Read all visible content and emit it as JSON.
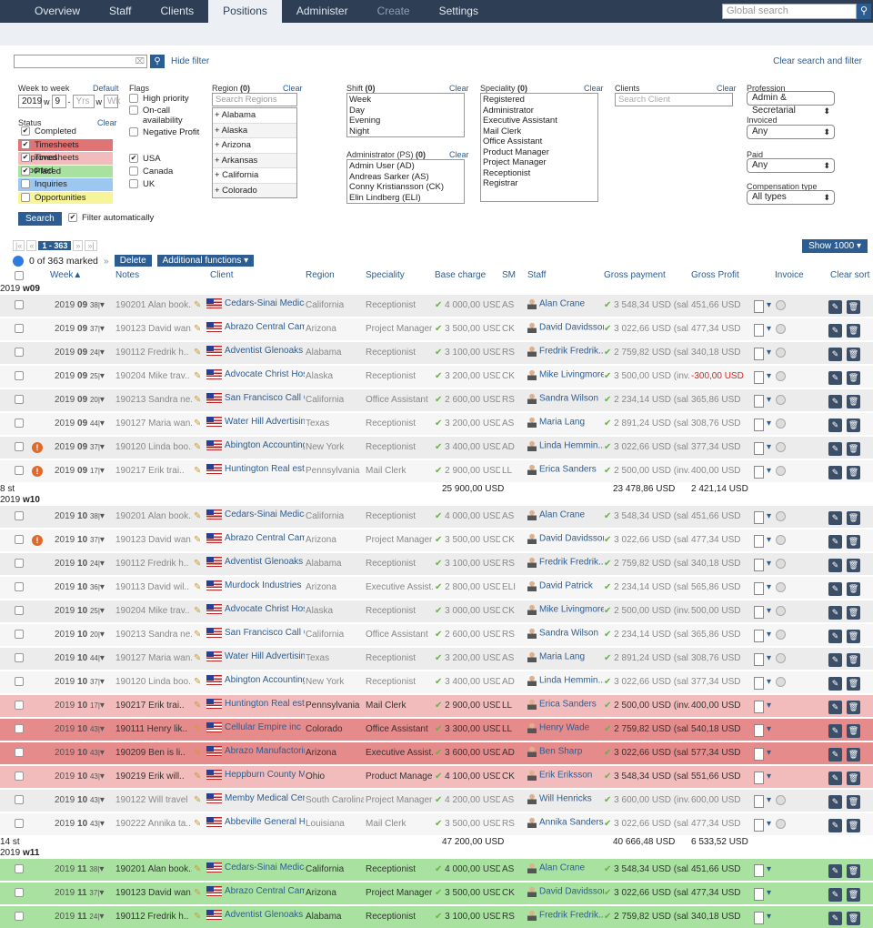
{
  "nav": {
    "tabs": [
      "Overview",
      "Staff",
      "Clients",
      "Positions",
      "Administer",
      "Create",
      "Settings"
    ],
    "active": 3,
    "dim": [
      5
    ],
    "search_placeholder": "Global search"
  },
  "filter": {
    "hide_filter": "Hide filter",
    "clear_all": "Clear search and filter",
    "week_label": "Week to week",
    "week_default": "Default",
    "year": "2019",
    "w": "w",
    "week": "9",
    "dash": "-",
    "yrs_ph": "Yrs",
    "wk_ph": "Wk",
    "status_label": "Status",
    "clear": "Clear",
    "statuses": [
      {
        "label": "Completed",
        "checked": true,
        "color": "#ffffff"
      },
      {
        "label": "Timesheets approved",
        "checked": true,
        "color": "#e07373"
      },
      {
        "label": "Timesheets reported",
        "checked": true,
        "color": "#f2bcbc"
      },
      {
        "label": "Placed",
        "checked": true,
        "color": "#a9e2a0"
      },
      {
        "label": "Inquiries",
        "checked": false,
        "color": "#9cc7f0"
      },
      {
        "label": "Opportunities",
        "checked": false,
        "color": "#f7f59a"
      }
    ],
    "search_btn": "Search",
    "filter_auto": "Filter automatically",
    "flags_label": "Flags",
    "flags": [
      "High priority",
      "On-call availability",
      "Negative Profit"
    ],
    "countries": [
      {
        "label": "USA",
        "checked": true
      },
      {
        "label": "Canada",
        "checked": false
      },
      {
        "label": "UK",
        "checked": false
      }
    ],
    "region_label": "Region",
    "region_count": "(0)",
    "region_search": "Search Regions",
    "regions": [
      "+ Alabama",
      "+ Alaska",
      "+ Arizona",
      "+ Arkansas",
      "+ California",
      "+ Colorado"
    ],
    "shift_label": "Shift",
    "shift_count": "(0)",
    "shifts": [
      "Week",
      "Day",
      "Evening",
      "Night"
    ],
    "admin_label": "Administrator (PS)",
    "admin_count": "(0)",
    "admins": [
      "Admin User (AD)",
      "Andreas Sarker (AS)",
      "Conny Kristiansson (CK)",
      "Elin Lindberg (ELI)"
    ],
    "spec_label": "Speciality",
    "spec_count": "(0)",
    "specs": [
      "Registered",
      "Administrator",
      "Executive Assistant",
      "Mail Clerk",
      "Office Assistant",
      "Product Manager",
      "Project Manager",
      "Receptionist",
      "Registrar"
    ],
    "clients_label": "Clients",
    "clients_search": "Search Client",
    "profession_label": "Profession",
    "profession": "Admin & Secretarial",
    "invoiced_label": "Invoiced",
    "invoiced": "Any",
    "paid_label": "Paid",
    "paid": "Any",
    "comp_label": "Compensation type",
    "comp": "All types"
  },
  "pager": {
    "first": "|«",
    "prev": "«",
    "range": "1 - 363",
    "next": "»",
    "last": "»|",
    "show": "Show 1000"
  },
  "actions": {
    "marked": "0 of 363 marked",
    "arrows": "»",
    "delete": "Delete",
    "additional": "Additional functions"
  },
  "columns": {
    "week": "Week",
    "notes": "Notes",
    "client": "Client",
    "region": "Region",
    "speciality": "Speciality",
    "base": "Base charge",
    "sm": "SM",
    "staff": "Staff",
    "gross": "Gross payment",
    "profit": "Gross Profit",
    "invoice": "Invoice",
    "clear_sort": "Clear sort"
  },
  "groups": [
    {
      "label": "2019",
      "week": "w09",
      "total_count": "8 st",
      "total_base": "25 900,00 USD",
      "total_gross": "23 478,86 USD",
      "total_profit": "2 421,14 USD",
      "rows": [
        {
          "c": "n",
          "y": "2019",
          "w": "09",
          "d": "38|",
          "note": "190201 Alan book..",
          "client": "Cedars-Sinai Medical...",
          "region": "California",
          "spec": "Receptionist",
          "base": "4 000,00 USD",
          "sm": "AS",
          "staff": "Alan Crane",
          "gross": "3 548,34 USD (sal...",
          "profit": "451,66 USD",
          "warn": false,
          "neg": false
        },
        {
          "c": "n",
          "y": "2019",
          "w": "09",
          "d": "37|",
          "note": "190123 David wan..",
          "client": "Abrazo Central Cam...",
          "region": "Arizona",
          "spec": "Project Manager",
          "base": "3 500,00 USD",
          "sm": "CK",
          "staff": "David Davidsson",
          "gross": "3 022,66 USD (sal...",
          "profit": "477,34 USD",
          "warn": false,
          "neg": false
        },
        {
          "c": "n",
          "y": "2019",
          "w": "09",
          "d": "24|",
          "note": "190112 Fredrik h..",
          "client": "Adventist Glenoaks",
          "region": "Alabama",
          "spec": "Receptionist",
          "base": "3 100,00 USD",
          "sm": "RS",
          "staff": "Fredrik Fredrik...",
          "gross": "2 759,82 USD (sal...",
          "profit": "340,18 USD",
          "warn": false,
          "neg": false
        },
        {
          "c": "n",
          "y": "2019",
          "w": "09",
          "d": "25|",
          "note": "190204 Mike trav..",
          "client": "Advocate Christ Hos...",
          "region": "Alaska",
          "spec": "Receptionist",
          "base": "3 200,00 USD",
          "sm": "CK",
          "staff": "Mike Livingmore",
          "gross": "3 500,00 USD (inv...",
          "profit": "-300,00 USD",
          "warn": false,
          "neg": true
        },
        {
          "c": "n",
          "y": "2019",
          "w": "09",
          "d": "20|",
          "note": "190213 Sandra ne..",
          "client": "San Francisco Call C...",
          "region": "California",
          "spec": "Office Assistant",
          "base": "2 600,00 USD",
          "sm": "RS",
          "staff": "Sandra Wilson",
          "gross": "2 234,14 USD (sal...",
          "profit": "365,86 USD",
          "warn": false,
          "neg": false
        },
        {
          "c": "n",
          "y": "2019",
          "w": "09",
          "d": "44|",
          "note": "190127 Maria wan..",
          "client": "Water Hill Advertising",
          "region": "Texas",
          "spec": "Receptionist",
          "base": "3 200,00 USD",
          "sm": "AS",
          "staff": "Maria Lang",
          "gross": "2 891,24 USD (sal...",
          "profit": "308,76 USD",
          "warn": false,
          "neg": false
        },
        {
          "c": "n",
          "y": "2019",
          "w": "09",
          "d": "37|",
          "note": "190120 Linda boo..",
          "client": "Abington Accounting...",
          "region": "New York",
          "spec": "Receptionist",
          "base": "3 400,00 USD",
          "sm": "AD",
          "staff": "Linda Hemmin...",
          "gross": "3 022,66 USD (sal...",
          "profit": "377,34 USD",
          "warn": true,
          "neg": false
        },
        {
          "c": "n",
          "y": "2019",
          "w": "09",
          "d": "17|",
          "note": "190217 Erik trai..",
          "client": "Huntington Real est...",
          "region": "Pennsylvania",
          "spec": "Mail Clerk",
          "base": "2 900,00 USD",
          "sm": "LL",
          "staff": "Erica Sanders",
          "gross": "2 500,00 USD (inv...",
          "profit": "400,00 USD",
          "warn": true,
          "neg": false
        }
      ]
    },
    {
      "label": "2019",
      "week": "w10",
      "total_count": "14 st",
      "total_base": "47 200,00 USD",
      "total_gross": "40 666,48 USD",
      "total_profit": "6 533,52 USD",
      "rows": [
        {
          "c": "n",
          "y": "2019",
          "w": "10",
          "d": "38|",
          "note": "190201 Alan book..",
          "client": "Cedars-Sinai Medical...",
          "region": "California",
          "spec": "Receptionist",
          "base": "4 000,00 USD",
          "sm": "AS",
          "staff": "Alan Crane",
          "gross": "3 548,34 USD (sal...",
          "profit": "451,66 USD",
          "warn": false,
          "neg": false
        },
        {
          "c": "n",
          "y": "2019",
          "w": "10",
          "d": "37|",
          "note": "190123 David wan..",
          "client": "Abrazo Central Cam...",
          "region": "Arizona",
          "spec": "Project Manager",
          "base": "3 500,00 USD",
          "sm": "CK",
          "staff": "David Davidsson",
          "gross": "3 022,66 USD (sal...",
          "profit": "477,34 USD",
          "warn": true,
          "neg": false
        },
        {
          "c": "n",
          "y": "2019",
          "w": "10",
          "d": "24|",
          "note": "190112 Fredrik h..",
          "client": "Adventist Glenoaks",
          "region": "Alabama",
          "spec": "Receptionist",
          "base": "3 100,00 USD",
          "sm": "RS",
          "staff": "Fredrik Fredrik...",
          "gross": "2 759,82 USD (sal...",
          "profit": "340,18 USD",
          "warn": false,
          "neg": false
        },
        {
          "c": "n",
          "y": "2019",
          "w": "10",
          "d": "36|",
          "note": "190113 David wil..",
          "client": "Murdock Industries",
          "region": "Arizona",
          "spec": "Executive Assist...",
          "base": "2 800,00 USD",
          "sm": "ELI",
          "staff": "David Patrick",
          "gross": "2 234,14 USD (sal...",
          "profit": "565,86 USD",
          "warn": false,
          "neg": false
        },
        {
          "c": "n",
          "y": "2019",
          "w": "10",
          "d": "25|",
          "note": "190204 Mike trav..",
          "client": "Advocate Christ Hos...",
          "region": "Alaska",
          "spec": "Receptionist",
          "base": "3 000,00 USD",
          "sm": "CK",
          "staff": "Mike Livingmore",
          "gross": "2 500,00 USD (inv...",
          "profit": "500,00 USD",
          "warn": false,
          "neg": false
        },
        {
          "c": "n",
          "y": "2019",
          "w": "10",
          "d": "20|",
          "note": "190213 Sandra ne..",
          "client": "San Francisco Call C...",
          "region": "California",
          "spec": "Office Assistant",
          "base": "2 600,00 USD",
          "sm": "RS",
          "staff": "Sandra Wilson",
          "gross": "2 234,14 USD (sal...",
          "profit": "365,86 USD",
          "warn": false,
          "neg": false
        },
        {
          "c": "n",
          "y": "2019",
          "w": "10",
          "d": "44|",
          "note": "190127 Maria wan..",
          "client": "Water Hill Advertising",
          "region": "Texas",
          "spec": "Receptionist",
          "base": "3 200,00 USD",
          "sm": "AS",
          "staff": "Maria Lang",
          "gross": "2 891,24 USD (sal...",
          "profit": "308,76 USD",
          "warn": false,
          "neg": false
        },
        {
          "c": "n",
          "y": "2019",
          "w": "10",
          "d": "37|",
          "note": "190120 Linda boo..",
          "client": "Abington Accounting...",
          "region": "New York",
          "spec": "Receptionist",
          "base": "3 400,00 USD",
          "sm": "AD",
          "staff": "Linda Hemmin...",
          "gross": "3 022,66 USD (sal...",
          "profit": "377,34 USD",
          "warn": false,
          "neg": false
        },
        {
          "c": "r",
          "y": "2019",
          "w": "10",
          "d": "17|",
          "note": "190217 Erik trai..",
          "client": "Huntington Real est...",
          "region": "Pennsylvania",
          "spec": "Mail Clerk",
          "base": "2 900,00 USD",
          "sm": "LL",
          "staff": "Erica Sanders",
          "gross": "2 500,00 USD (inv...",
          "profit": "400,00 USD",
          "warn": false,
          "neg": false
        },
        {
          "c": "rr",
          "y": "2019",
          "w": "10",
          "d": "43|",
          "note": "190111 Henry lik..",
          "client": "Cellular Empire inc",
          "region": "Colorado",
          "spec": "Office Assistant",
          "base": "3 300,00 USD",
          "sm": "LL",
          "staff": "Henry Wade",
          "gross": "2 759,82 USD (sal...",
          "profit": "540,18 USD",
          "warn": false,
          "neg": false
        },
        {
          "c": "rr",
          "y": "2019",
          "w": "10",
          "d": "43|",
          "note": "190209 Ben is li..",
          "client": "Abrazo Manufactoring",
          "region": "Arizona",
          "spec": "Executive Assist...",
          "base": "3 600,00 USD",
          "sm": "AD",
          "staff": "Ben Sharp",
          "gross": "3 022,66 USD (sal...",
          "profit": "577,34 USD",
          "warn": false,
          "neg": false
        },
        {
          "c": "r",
          "y": "2019",
          "w": "10",
          "d": "43|",
          "note": "190219 Erik will..",
          "client": "Heppburn County M...",
          "region": "Ohio",
          "spec": "Product Manager",
          "base": "4 100,00 USD",
          "sm": "CK",
          "staff": "Erik Eriksson",
          "gross": "3 548,34 USD (sal...",
          "profit": "551,66 USD",
          "warn": false,
          "neg": false
        },
        {
          "c": "n",
          "y": "2019",
          "w": "10",
          "d": "43|",
          "note": "190122 Will travel",
          "client": "Memby Medical Cent...",
          "region": "South Carolina",
          "spec": "Project Manager",
          "base": "4 200,00 USD",
          "sm": "AS",
          "staff": "Will Henricks",
          "gross": "3 600,00 USD (inv...",
          "profit": "600,00 USD",
          "warn": false,
          "neg": false
        },
        {
          "c": "n",
          "y": "2019",
          "w": "10",
          "d": "43|",
          "note": "190222 Annika ta..",
          "client": "Abbeville General Ho...",
          "region": "Louisiana",
          "spec": "Mail Clerk",
          "base": "3 500,00 USD",
          "sm": "RS",
          "staff": "Annika Sanders",
          "gross": "3 022,66 USD (sal...",
          "profit": "477,34 USD",
          "warn": false,
          "neg": false
        }
      ]
    },
    {
      "label": "2019",
      "week": "w11",
      "rows": [
        {
          "c": "g",
          "y": "2019",
          "w": "11",
          "d": "38|",
          "note": "190201 Alan book..",
          "client": "Cedars-Sinai Medical...",
          "region": "California",
          "spec": "Receptionist",
          "base": "4 000,00 USD",
          "sm": "AS",
          "staff": "Alan Crane",
          "gross": "3 548,34 USD (sal...",
          "profit": "451,66 USD",
          "warn": false,
          "neg": false
        },
        {
          "c": "g",
          "y": "2019",
          "w": "11",
          "d": "37|",
          "note": "190123 David wan..",
          "client": "Abrazo Central Cam...",
          "region": "Arizona",
          "spec": "Project Manager",
          "base": "3 500,00 USD",
          "sm": "CK",
          "staff": "David Davidsson",
          "gross": "3 022,66 USD (sal...",
          "profit": "477,34 USD",
          "warn": false,
          "neg": false
        },
        {
          "c": "g",
          "y": "2019",
          "w": "11",
          "d": "24|",
          "note": "190112 Fredrik h..",
          "client": "Adventist Glenoaks",
          "region": "Alabama",
          "spec": "Receptionist",
          "base": "3 100,00 USD",
          "sm": "RS",
          "staff": "Fredrik Fredrik...",
          "gross": "2 759,82 USD (sal...",
          "profit": "340,18 USD",
          "warn": false,
          "neg": false
        }
      ]
    }
  ]
}
